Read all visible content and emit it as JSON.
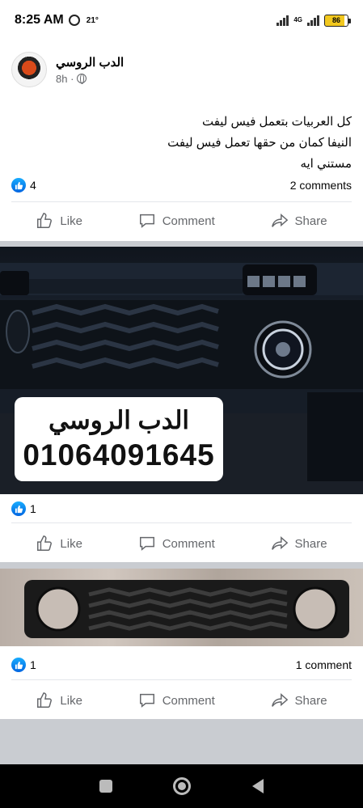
{
  "status_bar": {
    "time": "8:25 AM",
    "temperature": "21°",
    "network": "4G",
    "battery_level": "86"
  },
  "post": {
    "author": "الدب الروسي",
    "time": "8h ·",
    "text_lines": [
      "كل العربيات بتعمل فيس ليفت",
      "النيفا كمان من حقها تعمل فيس ليفت",
      "مستني ايه"
    ],
    "reactions": "4",
    "comments": "2 comments"
  },
  "actions": {
    "like": "Like",
    "comment": "Comment",
    "share": "Share"
  },
  "photo1": {
    "watermark_name": "الدب الروسي",
    "watermark_phone": "01064091645",
    "reactions": "1"
  },
  "photo2": {
    "reactions": "1",
    "comments": "1 comment"
  },
  "colors": {
    "accent": "#1877f2",
    "text_secondary": "#65676b",
    "feed_background": "#c9ccd1"
  },
  "icons": {
    "like": "thumb-up-icon",
    "comment": "speech-bubble-icon",
    "share": "share-arrow-icon",
    "privacy": "globe-icon"
  }
}
